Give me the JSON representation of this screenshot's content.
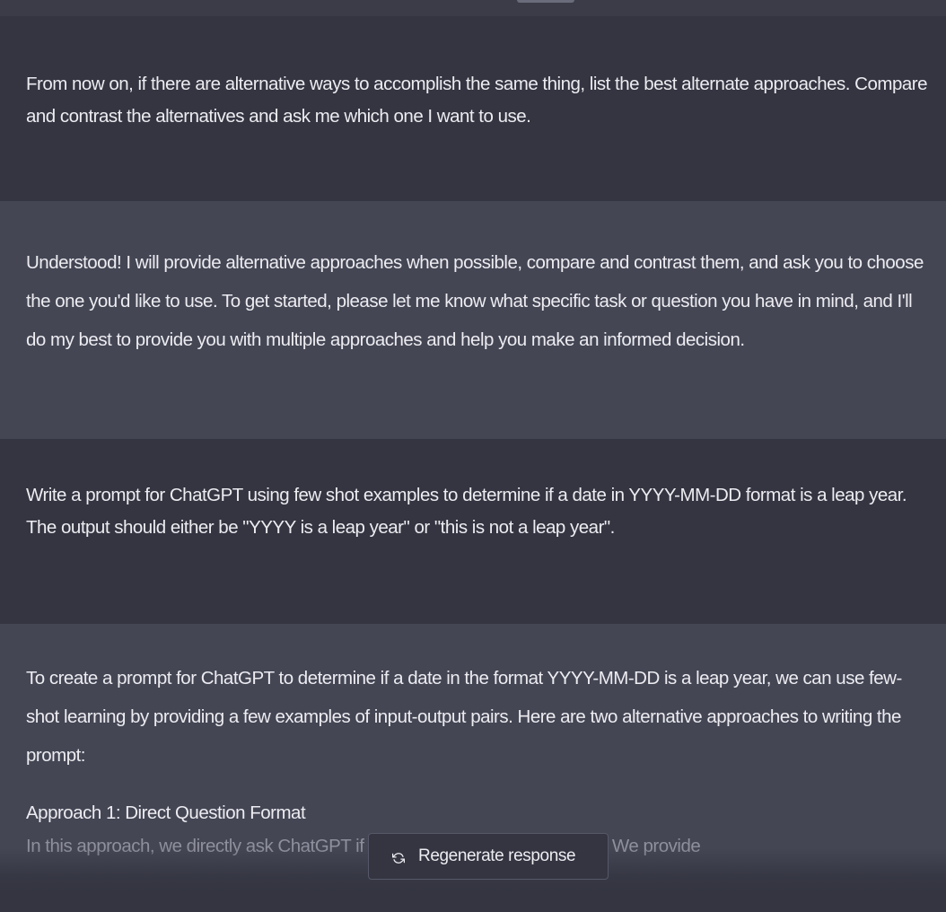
{
  "messages": [
    {
      "role": "user",
      "text": "From now on, if there are alternative ways to accomplish the same thing, list the best alternate approaches. Compare and contrast the alternatives and ask me which one I want to use."
    },
    {
      "role": "assistant",
      "text": "Understood! I will provide alternative approaches when possible, compare and contrast them, and ask you to choose the one you'd like to use. To get started, please let me know what specific task or question you have in mind, and I'll do my best to provide you with multiple approaches and help you make an informed decision."
    },
    {
      "role": "user",
      "text": "Write a prompt for ChatGPT using few shot examples to determine if a date in YYYY-MM-DD format is a leap year. The output should either be \"YYYY is a leap year\" or \"this is not a leap year\"."
    },
    {
      "role": "assistant",
      "text": "To create a prompt for ChatGPT to determine if a date in the format YYYY-MM-DD is a leap year, we can use few-shot learning by providing a few examples of input-output pairs. Here are two alternative approaches to writing the prompt:",
      "approach_title": "Approach 1: Direct Question Format",
      "partial_line": "In this approach, we directly ask ChatGPT if the given date is in a leap year. We provide"
    }
  ],
  "controls": {
    "regenerate_label": "Regenerate response",
    "regenerate_icon": "refresh-icon"
  },
  "colors": {
    "background_user": "#343541",
    "background_assistant": "#444654",
    "text": "#ececf1"
  }
}
